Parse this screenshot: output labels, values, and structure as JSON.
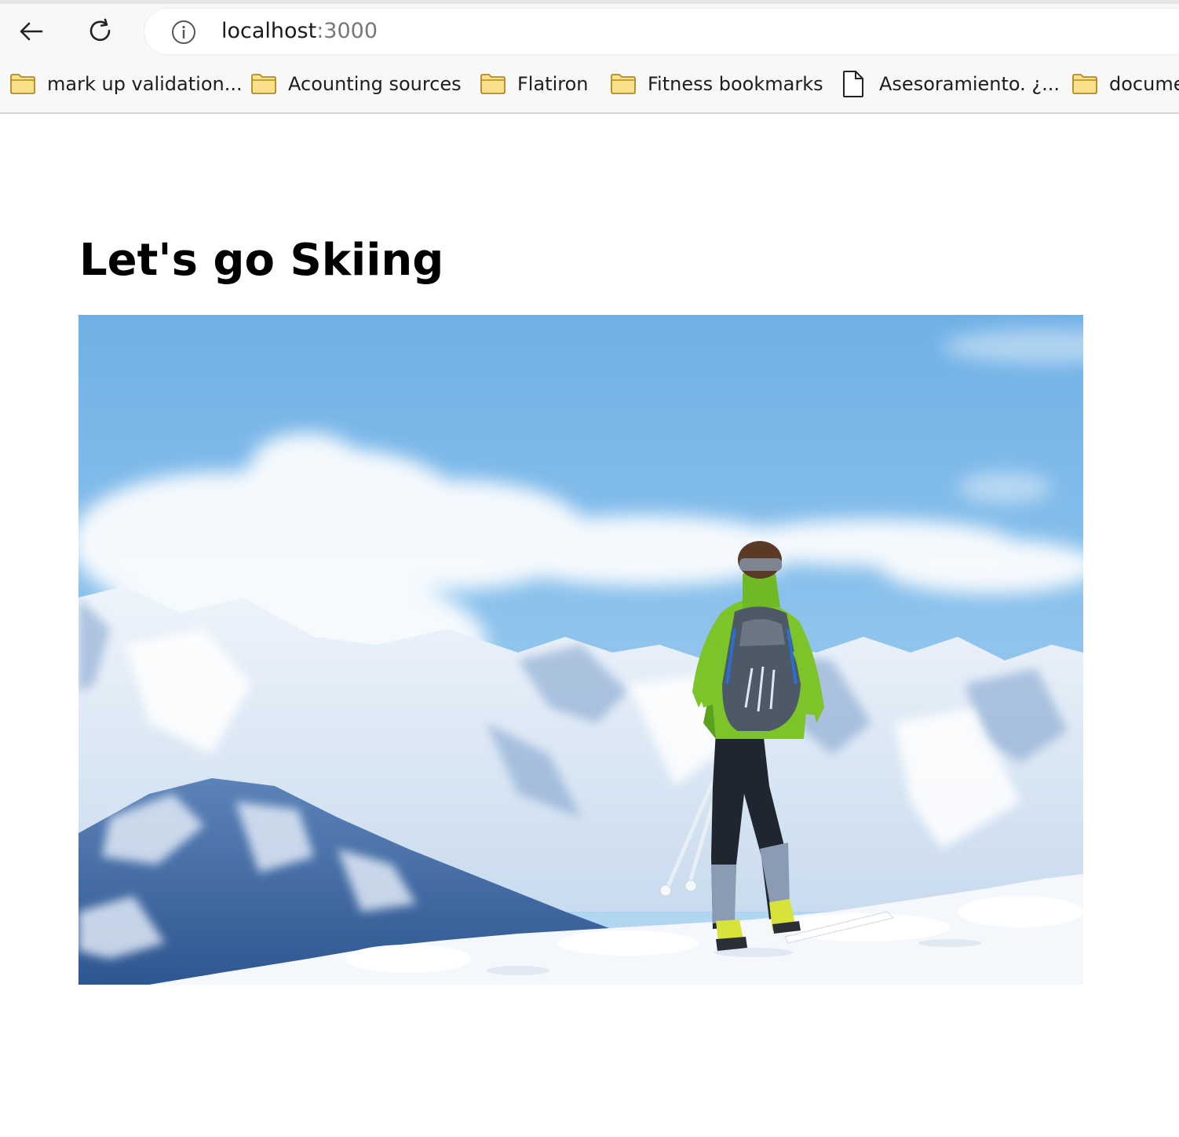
{
  "browser": {
    "url_host": "localhost",
    "url_port": ":3000",
    "bookmarks": [
      {
        "label": "mark up validation...",
        "icon": "folder-icon"
      },
      {
        "label": "Acounting sources",
        "icon": "folder-icon"
      },
      {
        "label": "Flatiron",
        "icon": "folder-icon"
      },
      {
        "label": "Fitness bookmarks",
        "icon": "folder-icon"
      },
      {
        "label": "Asesoramiento. ¿...",
        "icon": "document-icon"
      },
      {
        "label": "docume",
        "icon": "folder-icon"
      }
    ],
    "colors": {
      "folder_fill": "#fbe08c",
      "folder_stroke": "#b08a1e",
      "chrome_bg": "#f8f8f8"
    }
  },
  "page": {
    "title": "Let's go Skiing",
    "image": {
      "subject": "skier-on-mountain-photo",
      "colors": {
        "sky": "#6fb0e6",
        "jacket": "#7cc42a",
        "snow": "#f4f7fb",
        "mountains": "#3f6ea8"
      }
    }
  }
}
